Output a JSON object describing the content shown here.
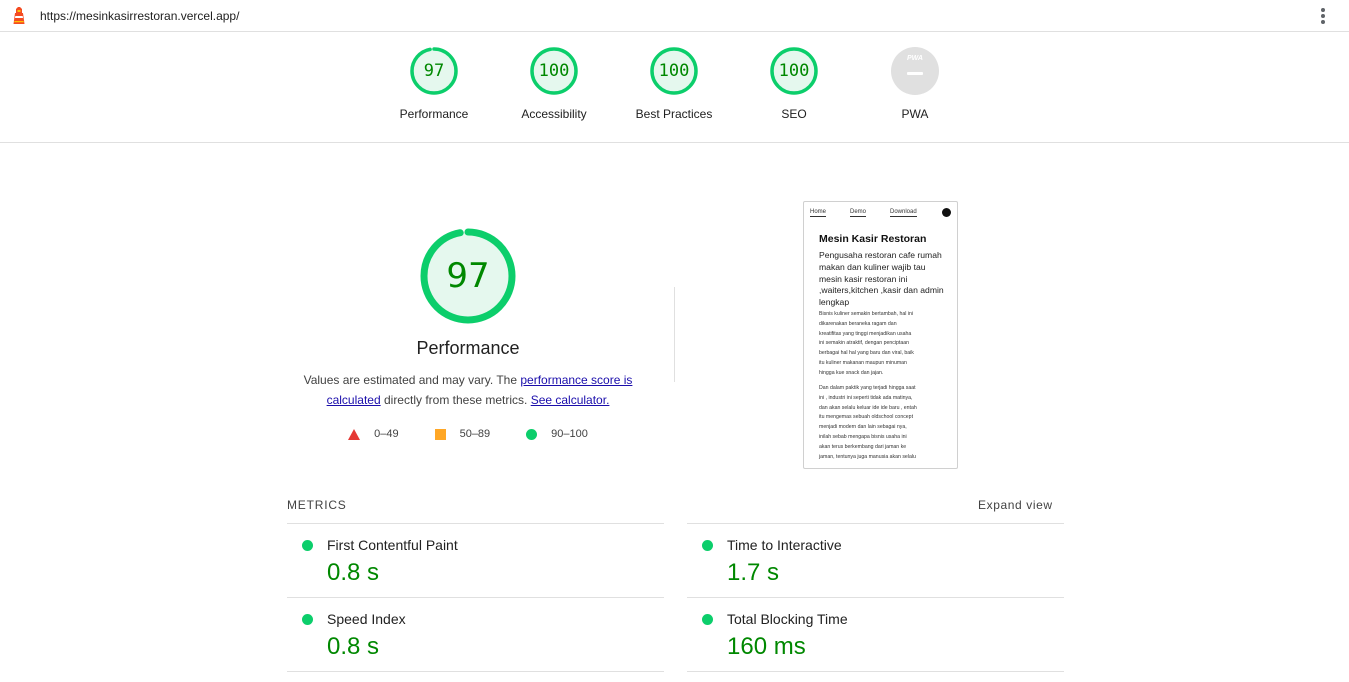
{
  "browser": {
    "url": "https://mesinkasirrestoran.vercel.app/",
    "logo_icon": "lighthouse-icon",
    "menu_icon": "kebab-menu-icon"
  },
  "categories": [
    {
      "label": "Performance",
      "score": "97",
      "value": 97
    },
    {
      "label": "Accessibility",
      "score": "100",
      "value": 100
    },
    {
      "label": "Best Practices",
      "score": "100",
      "value": 100
    },
    {
      "label": "SEO",
      "score": "100",
      "value": 100
    },
    {
      "label": "PWA",
      "score": "",
      "badge": "PWA"
    }
  ],
  "performance": {
    "score": "97",
    "value": 97,
    "title": "Performance",
    "desc_prefix": "Values are estimated and may vary. The ",
    "link1": "performance score is calculated",
    "desc_mid": " directly from these metrics. ",
    "link2": "See calculator."
  },
  "legend": [
    {
      "range": "0–49",
      "color": "#e53935",
      "shape": "triangle"
    },
    {
      "range": "50–89",
      "color": "#ffa726",
      "shape": "square"
    },
    {
      "range": "90–100",
      "color": "#0cce6b",
      "shape": "circle"
    }
  ],
  "thumbnail": {
    "nav": [
      "Home",
      "Demo",
      "Download"
    ],
    "heading": "Mesin Kasir Restoran",
    "subheading": "Pengusaha restoran cafe rumah makan dan kuliner wajib tau mesin kasir restoran ini ,waiters,kitchen ,kasir dan admin lengkap",
    "para1_lines": [
      "Bisnis kuliner semakin bertambah, hal ini",
      "dikarenakan beraneka ragam dan",
      "kreatifitas yang tinggi menjadikan usaha",
      "ini semakin atraktif, dengan penciptaan",
      "berbagai hal hal yang baru dan viral, baik",
      "itu kuliner makanan maupun minuman",
      "hingga kue snack dan jajan."
    ],
    "para2_lines": [
      "Dan dalam paktik yang terjadi hingga saat",
      "ini , industri ini seperti tidak ada matinya,",
      "dan akan selalu keluar ide ide baru , entah",
      "itu mengemas sebuah oldschool concept",
      "menjadi modern dan lain sebagai nya,",
      "inilah sebab mengapa bisnis usaha ini",
      "akan terus berkembang dari jaman ke",
      "jaman, tentunya juga manusia akan selalu"
    ]
  },
  "metrics": {
    "heading": "METRICS",
    "expand_label": "Expand view",
    "items": [
      {
        "title": "First Contentful Paint",
        "value": "0.8 s"
      },
      {
        "title": "Time to Interactive",
        "value": "1.7 s"
      },
      {
        "title": "Speed Index",
        "value": "0.8 s"
      },
      {
        "title": "Total Blocking Time",
        "value": "160 ms"
      }
    ]
  },
  "colors": {
    "pass": "#0cce6b",
    "pass_text": "#008800",
    "pass_fill": "#e5f8ee",
    "average": "#ffa726",
    "fail": "#e53935",
    "link": "#1a0dab"
  }
}
